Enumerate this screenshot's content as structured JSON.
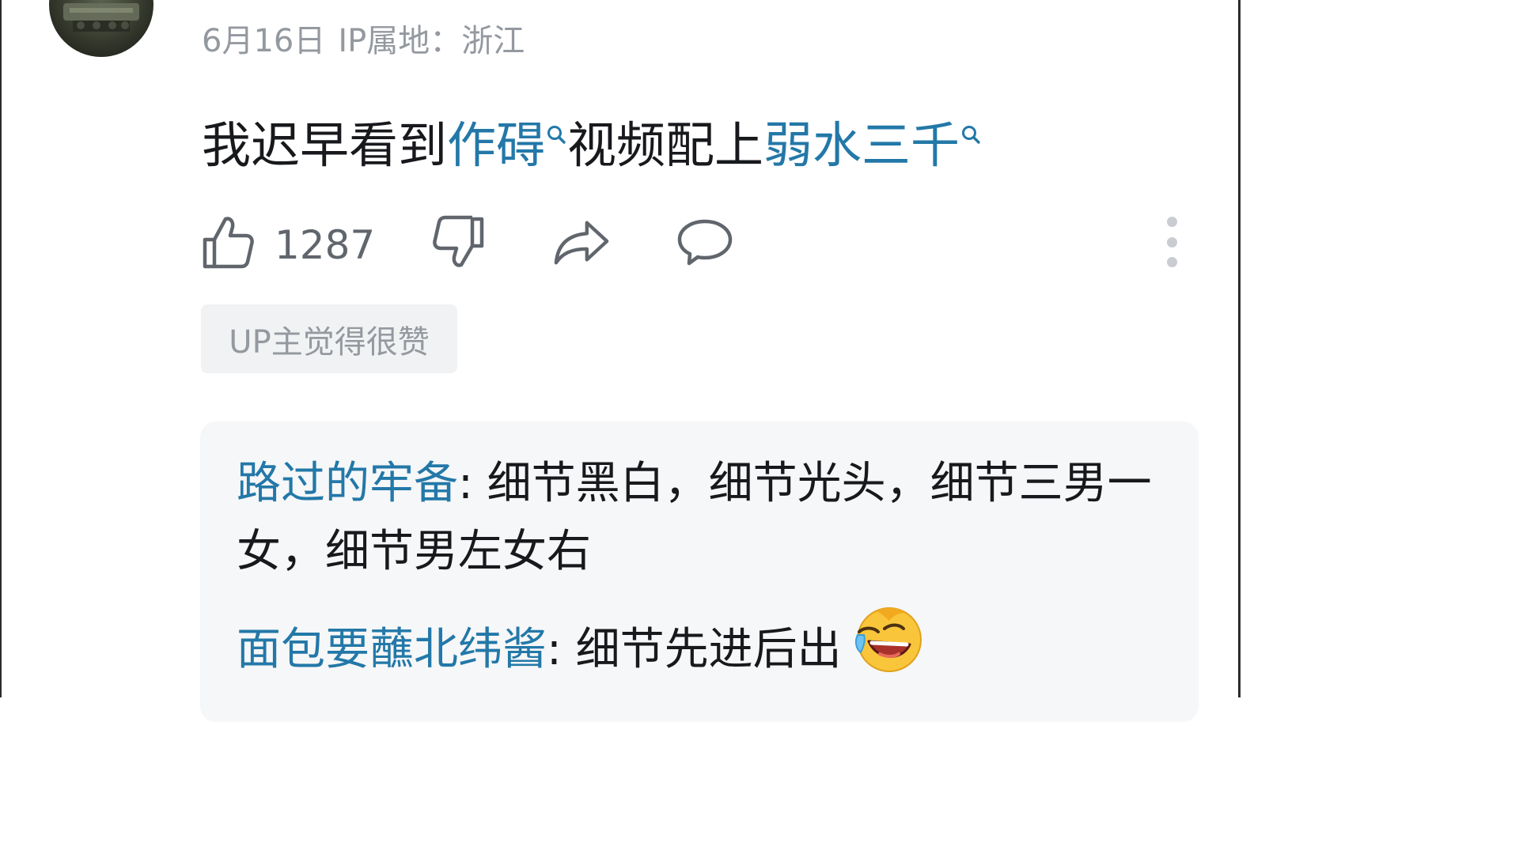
{
  "comment": {
    "date": "6月16日",
    "ip_location": "IP属地：浙江",
    "content_parts": [
      {
        "text": "我迟早看到",
        "type": "text"
      },
      {
        "text": "作碍",
        "type": "search-link"
      },
      {
        "text": "视频配上",
        "type": "text"
      },
      {
        "text": "弱水三千",
        "type": "search-link"
      }
    ],
    "like_count": "1287",
    "up_tag": "UP主觉得很赞"
  },
  "replies": [
    {
      "username": "路过的牢备",
      "separator": ":",
      "text": " 细节黑白，细节光头，细节三男一女，细节男左女右"
    },
    {
      "username": "面包要蘸北纬酱",
      "separator": ":",
      "text": " 细节先进后出",
      "emoji": "laughing-crying-emoji"
    }
  ],
  "colors": {
    "link": "#2378a8",
    "meta_gray": "#9499a0",
    "icon_gray": "#61666d",
    "reply_bg": "#f6f7f8",
    "tag_bg": "#f1f2f3"
  },
  "icons": [
    "like-icon",
    "dislike-icon",
    "share-icon",
    "reply-icon",
    "more-icon",
    "search-icon"
  ]
}
